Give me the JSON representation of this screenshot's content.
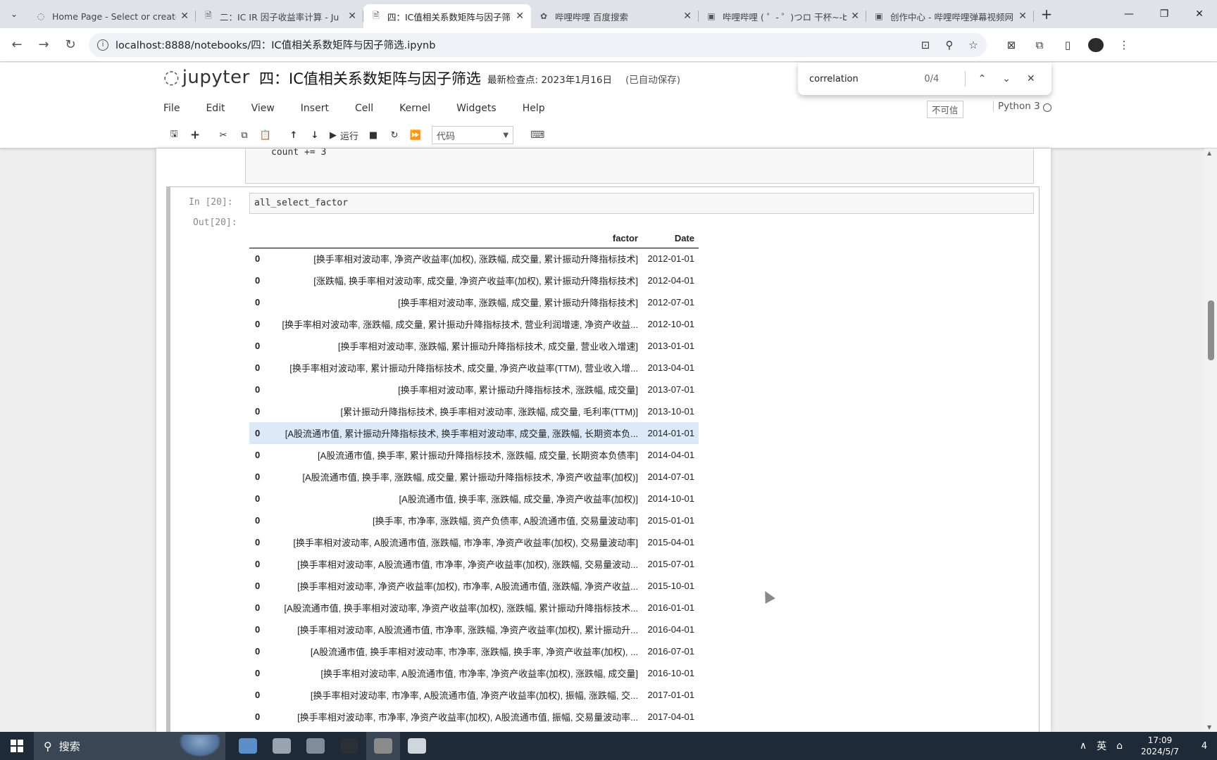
{
  "browser": {
    "tabs": [
      {
        "title": "Home Page - Select or create",
        "icon": "loading-icon"
      },
      {
        "title": "二：IC IR 因子收益率计算 - Ju",
        "icon": "notebook-icon"
      },
      {
        "title": "四：IC值相关系数矩阵与因子筛",
        "icon": "notebook-icon",
        "active": true
      },
      {
        "title": "哔哩哔哩 百度搜索",
        "icon": "paw-icon"
      },
      {
        "title": "哔哩哔哩 ( ゜- ゜)つロ 干杯~-bi",
        "icon": "bilibili-icon"
      },
      {
        "title": "创作中心 - 哔哩哔哩弹幕视频网",
        "icon": "bilibili-icon"
      }
    ],
    "url": "localhost:8888/notebooks/四：IC值相关系数矩阵与因子筛选.ipynb"
  },
  "find": {
    "query": "correlation",
    "count": "0/4"
  },
  "jupyter": {
    "logo_text": "jupyter",
    "notebook_title": "四：IC值相关系数矩阵与因子筛选",
    "checkpoint": "最新检查点: 2023年1月16日",
    "autosave": "(已自动保存)",
    "menu": [
      "File",
      "Edit",
      "View",
      "Insert",
      "Cell",
      "Kernel",
      "Widgets",
      "Help"
    ],
    "trusted": "不可信",
    "kernel": "Python 3",
    "run_label": "运行",
    "cell_type": "代码"
  },
  "prev_cell": {
    "code": "count += 3"
  },
  "cell": {
    "in_prompt": "In  [20]:",
    "code": "all_select_factor",
    "out_prompt": "Out[20]:"
  },
  "dataframe": {
    "columns": [
      "factor",
      "Date"
    ],
    "rows": [
      {
        "idx": "0",
        "factor": "[换手率相对波动率, 净资产收益率(加权), 涨跌幅, 成交量, 累计振动升降指标技术]",
        "date": "2012-01-01"
      },
      {
        "idx": "0",
        "factor": "[涨跌幅, 换手率相对波动率, 成交量, 净资产收益率(加权), 累计振动升降指标技术]",
        "date": "2012-04-01"
      },
      {
        "idx": "0",
        "factor": "[换手率相对波动率, 涨跌幅, 成交量, 累计振动升降指标技术]",
        "date": "2012-07-01"
      },
      {
        "idx": "0",
        "factor": "[换手率相对波动率, 涨跌幅, 成交量, 累计振动升降指标技术, 营业利润增速, 净资产收益...",
        "date": "2012-10-01"
      },
      {
        "idx": "0",
        "factor": "[换手率相对波动率, 涨跌幅, 累计振动升降指标技术, 成交量, 营业收入增速]",
        "date": "2013-01-01"
      },
      {
        "idx": "0",
        "factor": "[换手率相对波动率, 累计振动升降指标技术, 成交量, 净资产收益率(TTM), 营业收入增...",
        "date": "2013-04-01"
      },
      {
        "idx": "0",
        "factor": "[换手率相对波动率, 累计振动升降指标技术, 涨跌幅, 成交量]",
        "date": "2013-07-01"
      },
      {
        "idx": "0",
        "factor": "[累计振动升降指标技术, 换手率相对波动率, 涨跌幅, 成交量, 毛利率(TTM)]",
        "date": "2013-10-01"
      },
      {
        "idx": "0",
        "factor": "[A股流通市值, 累计振动升降指标技术, 换手率相对波动率, 成交量, 涨跌幅, 长期资本负...",
        "date": "2014-01-01",
        "highlight": true
      },
      {
        "idx": "0",
        "factor": "[A股流通市值, 换手率, 累计振动升降指标技术, 涨跌幅, 成交量, 长期资本负债率]",
        "date": "2014-04-01"
      },
      {
        "idx": "0",
        "factor": "[A股流通市值, 换手率, 涨跌幅, 成交量, 累计振动升降指标技术, 净资产收益率(加权)]",
        "date": "2014-07-01"
      },
      {
        "idx": "0",
        "factor": "[A股流通市值, 换手率, 涨跌幅, 成交量, 净资产收益率(加权)]",
        "date": "2014-10-01"
      },
      {
        "idx": "0",
        "factor": "[换手率, 市净率, 涨跌幅, 资产负债率, A股流通市值, 交易量波动率]",
        "date": "2015-01-01"
      },
      {
        "idx": "0",
        "factor": "[换手率相对波动率, A股流通市值, 涨跌幅, 市净率, 净资产收益率(加权), 交易量波动率]",
        "date": "2015-04-01"
      },
      {
        "idx": "0",
        "factor": "[换手率相对波动率, A股流通市值, 市净率, 净资产收益率(加权), 涨跌幅, 交易量波动...",
        "date": "2015-07-01"
      },
      {
        "idx": "0",
        "factor": "[换手率相对波动率, 净资产收益率(加权), 市净率, A股流通市值, 涨跌幅, 净资产收益...",
        "date": "2015-10-01"
      },
      {
        "idx": "0",
        "factor": "[A股流通市值, 换手率相对波动率, 净资产收益率(加权), 涨跌幅, 累计振动升降指标技术...",
        "date": "2016-01-01"
      },
      {
        "idx": "0",
        "factor": "[换手率相对波动率, A股流通市值, 市净率, 涨跌幅, 净资产收益率(加权), 累计振动升...",
        "date": "2016-04-01"
      },
      {
        "idx": "0",
        "factor": "[A股流通市值, 换手率相对波动率, 市净率, 涨跌幅, 换手率, 净资产收益率(加权), ...",
        "date": "2016-07-01"
      },
      {
        "idx": "0",
        "factor": "[换手率相对波动率, A股流通市值, 市净率, 净资产收益率(加权), 涨跌幅, 成交量]",
        "date": "2016-10-01"
      },
      {
        "idx": "0",
        "factor": "[换手率相对波动率, 市净率, A股流通市值, 净资产收益率(加权), 振幅, 涨跌幅, 交...",
        "date": "2017-01-01"
      },
      {
        "idx": "0",
        "factor": "[换手率相对波动率, 市净率, 净资产收益率(加权), A股流通市值, 振幅, 交易量波动率...",
        "date": "2017-04-01"
      }
    ]
  },
  "taskbar": {
    "search_label": "搜索",
    "ime": "英",
    "time": "17:09",
    "date": "2024/5/7",
    "notification_count": "4",
    "apps": [
      {
        "name": "app-fish",
        "color": "#5b8fc9"
      },
      {
        "name": "app-key",
        "color": "#9aa4ae"
      },
      {
        "name": "app-monitor",
        "color": "#7f8c99"
      },
      {
        "name": "app-terminal",
        "color": "#2b2f36"
      },
      {
        "name": "app-jupyter",
        "color": "#8a8a8a",
        "active": true
      },
      {
        "name": "app-wechat",
        "color": "#cfd6dd"
      }
    ]
  }
}
